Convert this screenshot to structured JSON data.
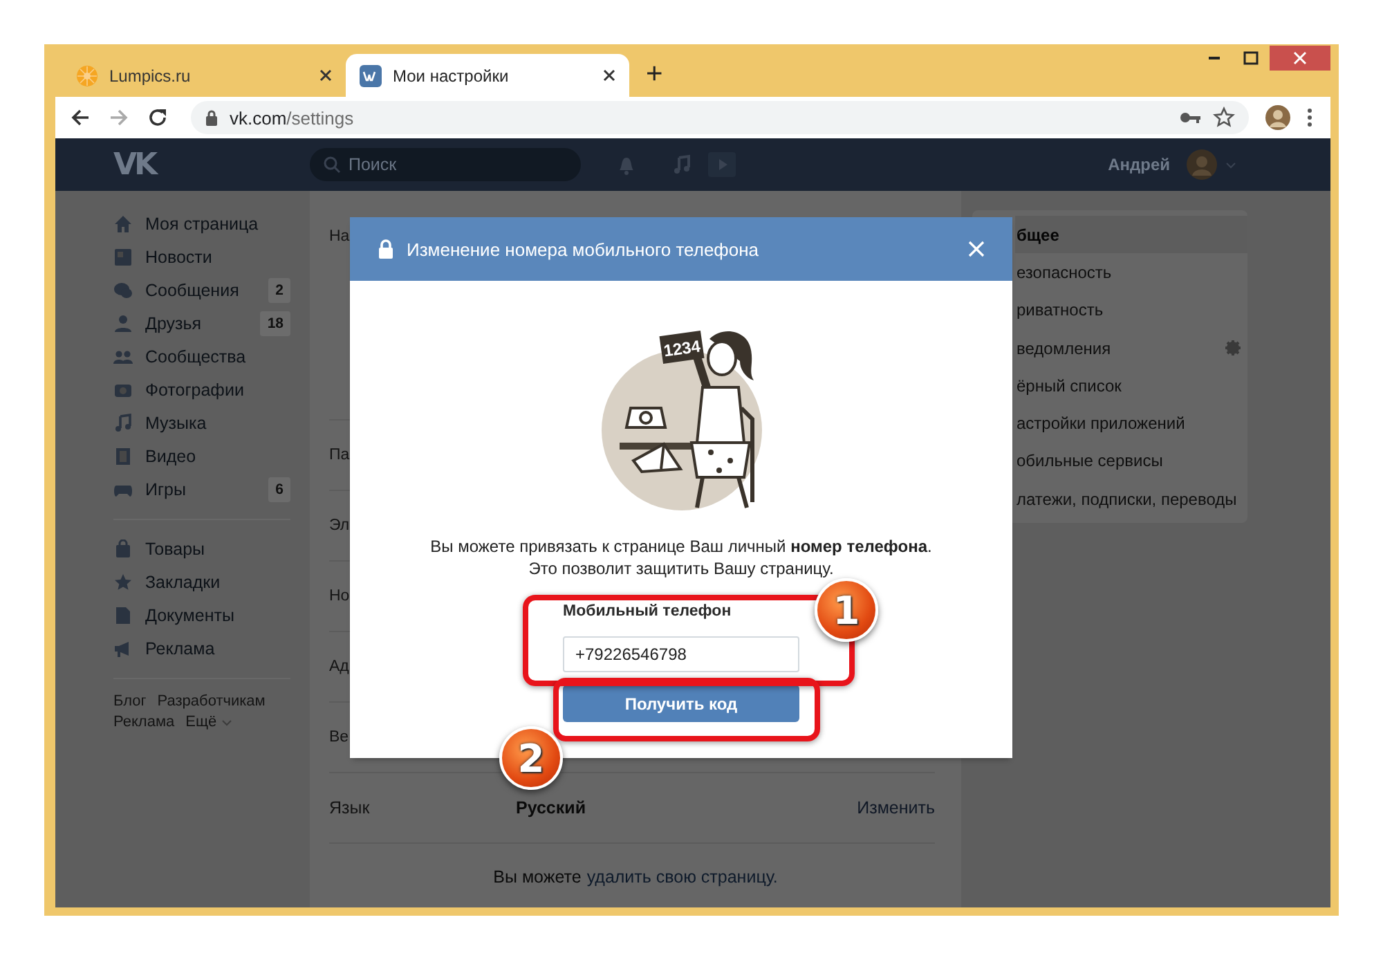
{
  "browser": {
    "tabs": [
      {
        "title": "Lumpics.ru",
        "selected": false
      },
      {
        "title": "Мои настройки",
        "selected": true
      }
    ],
    "new_tab": "+",
    "address": {
      "host": "vk.com",
      "path": "/settings"
    }
  },
  "header": {
    "logo": "VK",
    "search_placeholder": "Поиск",
    "user_name": "Андрей"
  },
  "sidebar": {
    "items": [
      {
        "label": "Моя страница"
      },
      {
        "label": "Новости"
      },
      {
        "label": "Сообщения",
        "count": "2"
      },
      {
        "label": "Друзья",
        "count": "18"
      },
      {
        "label": "Сообщества"
      },
      {
        "label": "Фотографии"
      },
      {
        "label": "Музыка"
      },
      {
        "label": "Видео"
      },
      {
        "label": "Игры",
        "count": "6"
      }
    ],
    "items_2": [
      {
        "label": "Товары"
      },
      {
        "label": "Закладки"
      },
      {
        "label": "Документы"
      },
      {
        "label": "Реклама"
      }
    ],
    "footer_links": [
      "Блог",
      "Разработчикам",
      "Реклама",
      "Ещё"
    ]
  },
  "settings": {
    "rows": [
      {
        "label": "На"
      },
      {
        "label": "Па"
      },
      {
        "label": "Эл"
      },
      {
        "label": "Но"
      },
      {
        "label": "Ад"
      },
      {
        "label": "Ве"
      },
      {
        "label": "Язык",
        "value": "Русский",
        "action": "Изменить"
      }
    ],
    "footer": {
      "text": "Вы можете",
      "link": "удалить свою страницу."
    }
  },
  "menu": {
    "items": [
      {
        "label": "бщее",
        "selected": true
      },
      {
        "label": "езопасность",
        "selected": false
      },
      {
        "label": "риватность",
        "selected": false
      },
      {
        "label": "ведомления",
        "selected": false
      },
      {
        "label": "ёрный список",
        "selected": false
      },
      {
        "label": "астройки приложений",
        "selected": false
      },
      {
        "label": "обильные сервисы",
        "selected": false
      },
      {
        "label": "латежи, подписки, переводы",
        "selected": false
      }
    ]
  },
  "modal": {
    "title": "Изменение номера мобильного телефона",
    "sign": "1234",
    "description": [
      "Вы можете привязать к странице Ваш личный **номер телефона**.",
      "Это позволит защитить Вашу страницу."
    ],
    "field_label": "Мобильный телефон",
    "phone": "+79226546798",
    "button": "Получить код"
  },
  "annotations": [
    {
      "number": "1"
    },
    {
      "number": "2"
    }
  ]
}
